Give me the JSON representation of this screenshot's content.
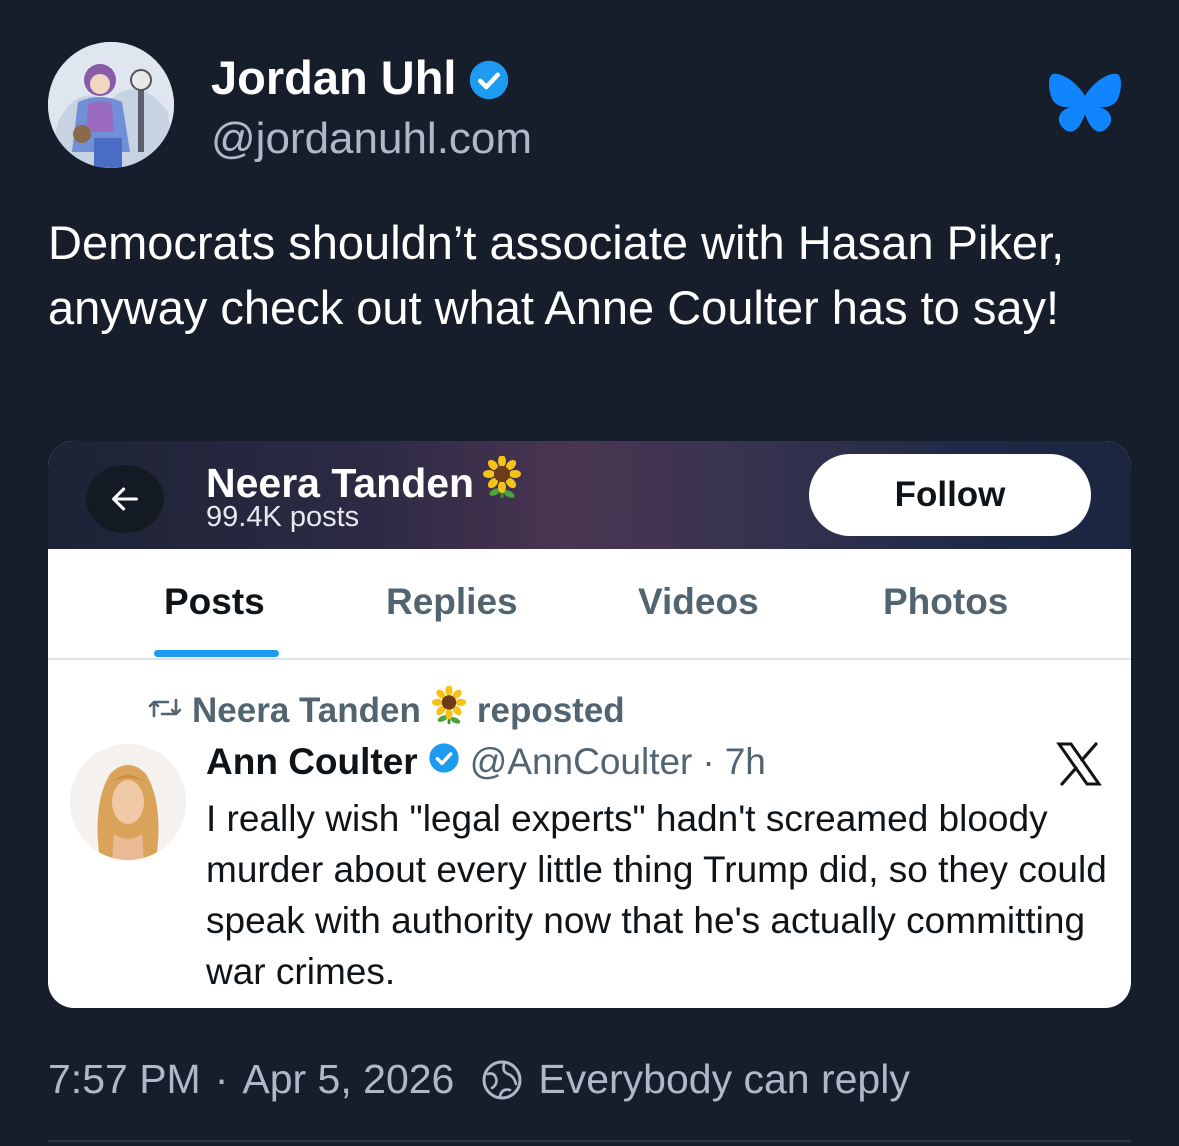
{
  "author": {
    "name": "Jordan Uhl",
    "handle": "@jordanuhl.com",
    "verified_icon": "verified-badge-icon",
    "avatar_icon": "cartoon-avatar"
  },
  "platform_icon": "bluesky-butterfly-icon",
  "post": {
    "text": "Democrats shouldn’t associate with Hasan Piker, anyway check out what Anne Coulter has to say!"
  },
  "embed": {
    "profile_name": "Neera Tanden",
    "profile_emoji": "🌻",
    "post_count": "99.4K posts",
    "follow_label": "Follow",
    "tabs": [
      {
        "label": "Posts",
        "active": true
      },
      {
        "label": "Replies",
        "active": false
      },
      {
        "label": "Videos",
        "active": false
      },
      {
        "label": "Photos",
        "active": false
      }
    ],
    "repost": {
      "name": "Neera Tanden",
      "suffix": "reposted"
    },
    "tweet": {
      "author": "Ann Coulter",
      "handle": "@AnnCoulter",
      "separator": "·",
      "time": "7h",
      "text": "I really wish \"legal experts\" hadn't screamed bloody murder about every little thing Trump did, so they could speak with authority now that he's actually committing war crimes."
    }
  },
  "footer": {
    "time": "7:57 PM",
    "separator": "·",
    "date": "Apr 5, 2026",
    "reply_setting": "Everybody can reply"
  },
  "colors": {
    "background": "#161e2b",
    "accent_blue": "#1d9bf0",
    "bluesky_blue": "#1185fe",
    "muted_text": "#aeb8c6"
  }
}
